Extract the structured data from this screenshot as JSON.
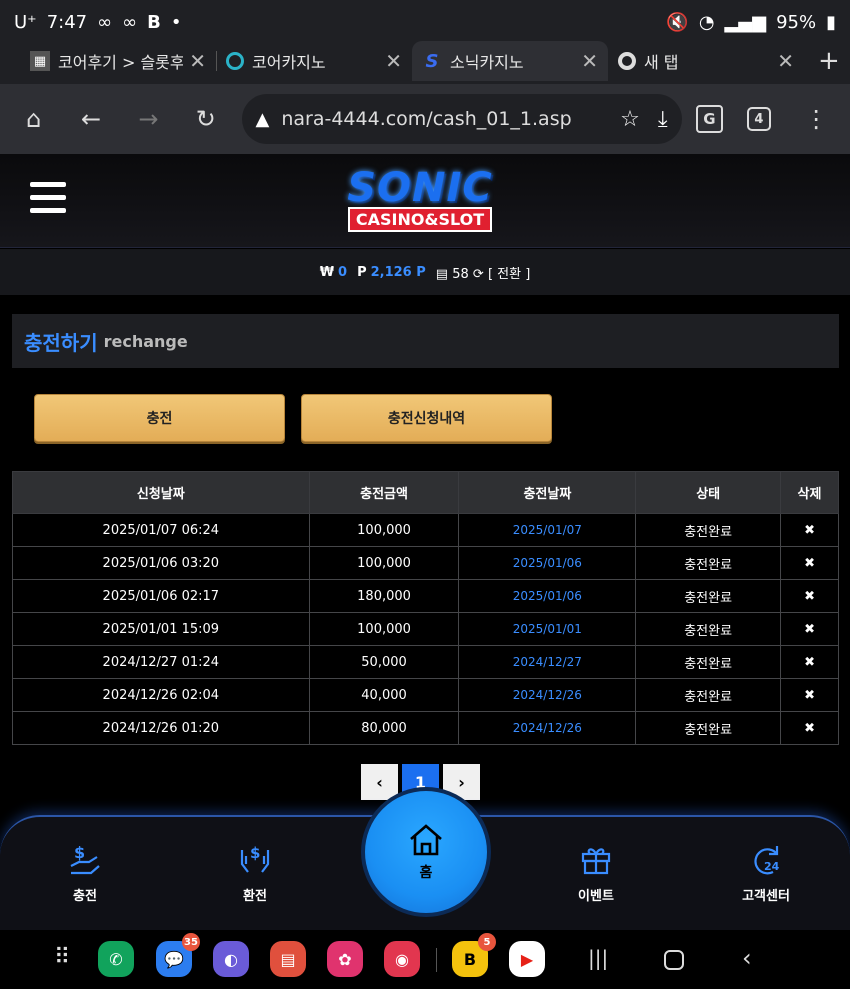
{
  "status": {
    "carrier": "U⁺",
    "time": "7:47",
    "battery": "95%"
  },
  "tabs": [
    {
      "title": "코어후기 > 슬롯후",
      "active": false
    },
    {
      "title": "코어카지노",
      "active": false
    },
    {
      "title": "소닉카지노",
      "active": true
    },
    {
      "title": "새 탭",
      "active": false
    }
  ],
  "browser": {
    "url": "nara-4444.com/cash_01_1.asp",
    "tab_count": "4"
  },
  "logo": {
    "line1": "SONIC",
    "line2": "CASINO&SLOT"
  },
  "balance": {
    "won_symbol": "₩",
    "won": "0",
    "point_symbol": "P",
    "points": "2,126 P",
    "coupon": "58",
    "convert": "[ 전환 ]"
  },
  "section": {
    "title_ko": "충전하기",
    "title_en": "rechange"
  },
  "buttons": {
    "charge": "충전",
    "history": "충전신청내역"
  },
  "table": {
    "headers": [
      "신청날짜",
      "충전금액",
      "충전날짜",
      "상태",
      "삭제"
    ],
    "rows": [
      [
        "2025/01/07 06:24",
        "100,000",
        "2025/01/07",
        "충전완료",
        "✖"
      ],
      [
        "2025/01/06 03:20",
        "100,000",
        "2025/01/06",
        "충전완료",
        "✖"
      ],
      [
        "2025/01/06 02:17",
        "180,000",
        "2025/01/06",
        "충전완료",
        "✖"
      ],
      [
        "2025/01/01 15:09",
        "100,000",
        "2025/01/01",
        "충전완료",
        "✖"
      ],
      [
        "2024/12/27 01:24",
        "50,000",
        "2024/12/27",
        "충전완료",
        "✖"
      ],
      [
        "2024/12/26 02:04",
        "40,000",
        "2024/12/26",
        "충전완료",
        "✖"
      ],
      [
        "2024/12/26 01:20",
        "80,000",
        "2024/12/26",
        "충전완료",
        "✖"
      ]
    ]
  },
  "pager": {
    "prev": "‹",
    "current": "1",
    "next": "›"
  },
  "bottomnav": {
    "charge": "충전",
    "exchange": "환전",
    "home": "홈",
    "event": "이벤트",
    "support": "고객센터"
  },
  "apps": {
    "messages_badge": "35",
    "b_badge": "5"
  },
  "colors": {
    "accent": "#3a8dff",
    "gold": "#e9b764",
    "home": "#1a8ff3"
  }
}
